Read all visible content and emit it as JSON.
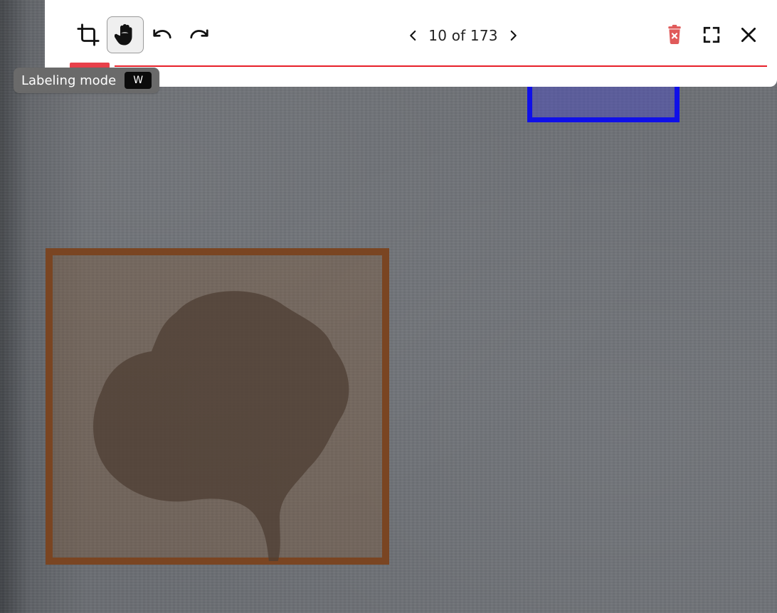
{
  "toolbar": {
    "pagination": {
      "text": "10 of 173"
    },
    "icons": {
      "crop": "crop-icon",
      "hand": "hand-icon",
      "undo": "undo-icon",
      "redo": "redo-icon",
      "prev": "chevron-left-icon",
      "next": "chevron-right-icon",
      "delete": "trash-icon",
      "fullscreen": "fullscreen-icon",
      "close": "close-icon"
    },
    "colors": {
      "accent_red": "#e8202a",
      "delete_red": "#e05a5a",
      "active_bg": "#efefef"
    }
  },
  "tooltip": {
    "label": "Labeling mode",
    "shortcut": "W"
  },
  "annotations": {
    "brown_box_color": "#7a4522",
    "blue_box_color": "#1010e8"
  }
}
